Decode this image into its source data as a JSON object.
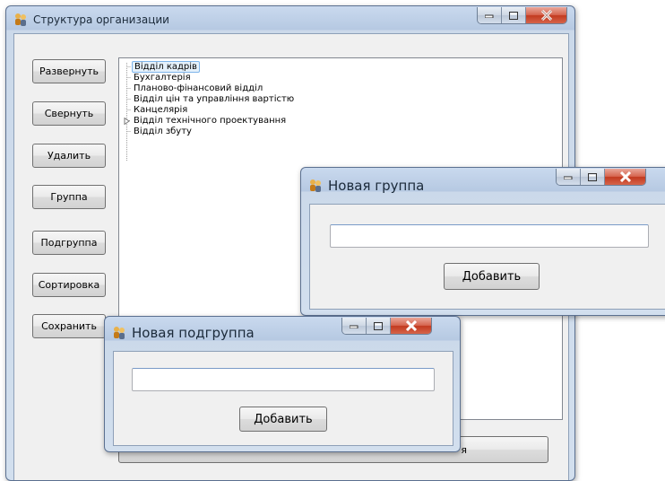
{
  "main_window": {
    "title": "Структура организации",
    "buttons": {
      "expand": "Развернуть",
      "collapse": "Свернуть",
      "delete": "Удалить",
      "group": "Группа",
      "subgroup": "Подгруппа",
      "sort": "Сортировка",
      "save": "Сохранить"
    },
    "partial_button_text": "я",
    "tree_items": [
      {
        "label": "Відділ кадрів",
        "selected": true
      },
      {
        "label": "Бухгалтерія"
      },
      {
        "label": "Планово-фінансовий відділ"
      },
      {
        "label": "Відділ цін та управління вартістю"
      },
      {
        "label": "Канцелярія"
      },
      {
        "label": "Відділ технічного проектування",
        "expandable": true
      },
      {
        "label": "Відділ збуту"
      }
    ]
  },
  "group_dialog": {
    "title": "Новая группа",
    "input_value": "",
    "add_button": "Добавить"
  },
  "subgroup_dialog": {
    "title": "Новая подгруппа",
    "input_value": "",
    "add_button": "Добавить"
  },
  "colors": {
    "frame": "#c9d9ee",
    "client": "#f0f0f0",
    "close_button": "#c23a1f",
    "selection": "#e5f1fb"
  }
}
